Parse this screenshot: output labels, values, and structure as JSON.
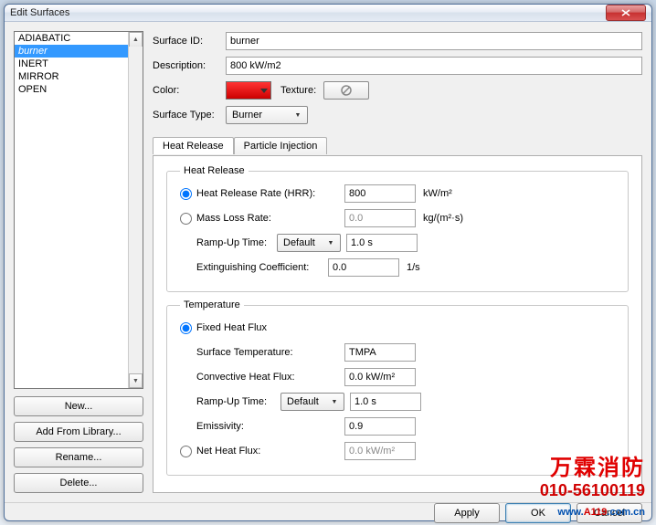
{
  "window": {
    "title": "Edit Surfaces"
  },
  "list": {
    "items": [
      "ADIABATIC",
      "burner",
      "INERT",
      "MIRROR",
      "OPEN"
    ],
    "selected_index": 1
  },
  "left_buttons": {
    "new": "New...",
    "add_lib": "Add From Library...",
    "rename": "Rename...",
    "delete": "Delete..."
  },
  "labels": {
    "surface_id": "Surface ID:",
    "description": "Description:",
    "color": "Color:",
    "texture": "Texture:",
    "surface_type": "Surface Type:"
  },
  "values": {
    "surface_id": "burner",
    "description": "800 kW/m2",
    "surface_type": "Burner"
  },
  "tabs": {
    "heat_release": "Heat Release",
    "particle_injection": "Particle Injection"
  },
  "hr": {
    "legend": "Heat Release",
    "hrr_label": "Heat Release Rate (HRR):",
    "hrr_value": "800",
    "hrr_unit": "kW/m²",
    "mlr_label": "Mass Loss Rate:",
    "mlr_value": "0.0",
    "mlr_unit": "kg/(m²·s)",
    "ramp_label": "Ramp-Up Time:",
    "ramp_mode": "Default",
    "ramp_value": "1.0 s",
    "ext_label": "Extinguishing Coefficient:",
    "ext_value": "0.0",
    "ext_unit": "1/s"
  },
  "temp": {
    "legend": "Temperature",
    "fixed_label": "Fixed Heat Flux",
    "surf_temp_label": "Surface Temperature:",
    "surf_temp_value": "TMPA",
    "conv_label": "Convective Heat Flux:",
    "conv_value": "0.0 kW/m²",
    "ramp_label": "Ramp-Up Time:",
    "ramp_mode": "Default",
    "ramp_value": "1.0 s",
    "emiss_label": "Emissivity:",
    "emiss_value": "0.9",
    "net_label": "Net Heat Flux:",
    "net_value": "0.0 kW/m²"
  },
  "dialog_buttons": {
    "apply": "Apply",
    "ok": "OK",
    "cancel": "Cancel"
  },
  "watermark": {
    "line1": "万霖消防",
    "line2a": "010-56100119",
    "line3_pre": "www.",
    "line3_red": "A119",
    "line3_post": ".com.cn"
  }
}
